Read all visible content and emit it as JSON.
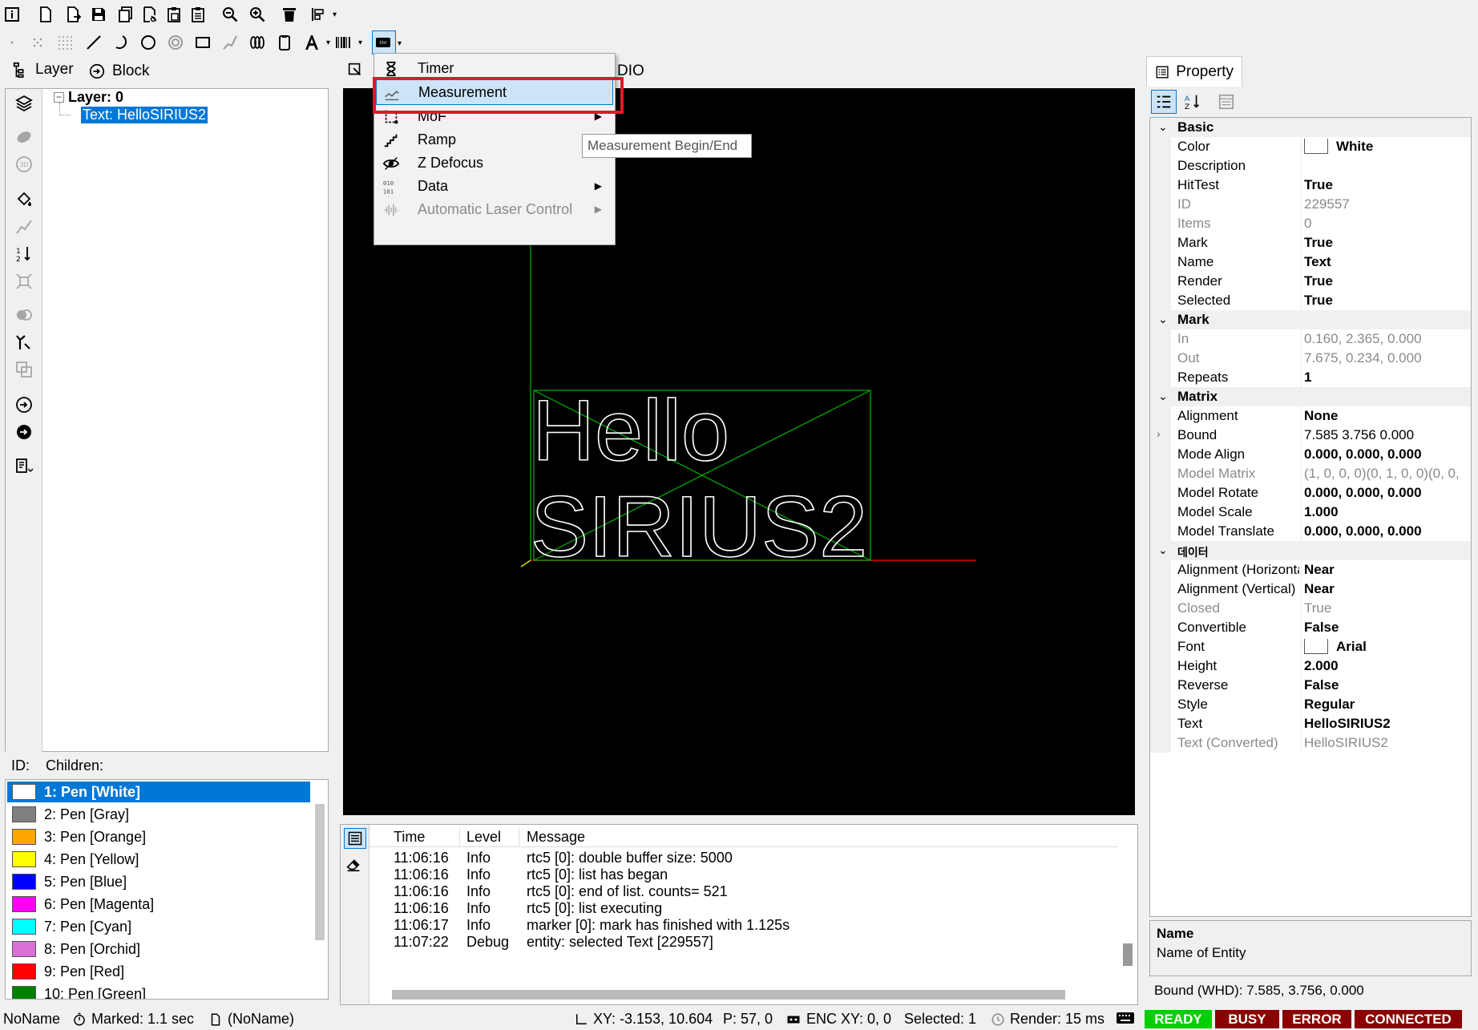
{
  "toolbar_icons": [
    "info-icon",
    "new-file-icon",
    "open-file-icon",
    "save-icon",
    "copy-icon",
    "cut-icon",
    "paste-icon",
    "clipboard-icon",
    "zoom-out-icon",
    "zoom-in-icon",
    "delete-icon",
    "align-icon",
    "point-icon",
    "points-icon",
    "grid-icon",
    "line-icon",
    "arc-icon",
    "circle-icon",
    "spiral-icon",
    "rectangle-icon",
    "trepan-icon",
    "spiral-coil-icon",
    "card-icon",
    "text-tool-icon",
    "barcode-icon",
    "control-icon"
  ],
  "left_panel": {
    "tabs": [
      {
        "label": "Layer"
      },
      {
        "label": "Block"
      }
    ],
    "tree": {
      "layer": "Layer: 0",
      "child": "Text: HelloSIRIUS2"
    },
    "id_label": "ID:",
    "children_label": "Children:"
  },
  "pens": [
    {
      "label": "1: Pen [White]",
      "color": "#ffffff"
    },
    {
      "label": "2: Pen [Gray]",
      "color": "#808080"
    },
    {
      "label": "3: Pen [Orange]",
      "color": "#ffa500"
    },
    {
      "label": "4: Pen [Yellow]",
      "color": "#ffff00"
    },
    {
      "label": "5: Pen [Blue]",
      "color": "#0000ff"
    },
    {
      "label": "6: Pen [Magenta]",
      "color": "#ff00ff"
    },
    {
      "label": "7: Pen [Cyan]",
      "color": "#00ffff"
    },
    {
      "label": "8: Pen [Orchid]",
      "color": "#da70d6"
    },
    {
      "label": "9: Pen [Red]",
      "color": "#ff0000"
    },
    {
      "label": "10: Pen [Green]",
      "color": "#008000"
    }
  ],
  "center": {
    "tab_partial": "DIO",
    "canvas_text": {
      "line1": "Hello",
      "line2": "SIRIUS2"
    }
  },
  "menu": {
    "items": [
      {
        "label": "Timer",
        "icon": "hourglass-icon",
        "submenu": false,
        "disabled": false
      },
      {
        "label": "Measurement",
        "icon": "measurement-icon",
        "submenu": false,
        "disabled": false
      },
      {
        "label": "MoF",
        "icon": "mof-icon",
        "submenu": true,
        "disabled": false
      },
      {
        "label": "Ramp",
        "icon": "ramp-icon",
        "submenu": false,
        "disabled": false
      },
      {
        "label": "Z Defocus",
        "icon": "eye-icon",
        "submenu": false,
        "disabled": false
      },
      {
        "label": "Data",
        "icon": "binary-data-icon",
        "submenu": true,
        "disabled": false
      },
      {
        "label": "Automatic Laser Control",
        "icon": "waveform-icon",
        "submenu": true,
        "disabled": true
      }
    ],
    "tooltip": "Measurement Begin/End"
  },
  "log": {
    "headers": {
      "time": "Time",
      "level": "Level",
      "message": "Message"
    },
    "rows": [
      {
        "time": "11:06:16",
        "level": "Info",
        "message": "rtc5 [0]: double buffer size: 5000"
      },
      {
        "time": "11:06:16",
        "level": "Info",
        "message": "rtc5 [0]: list has began"
      },
      {
        "time": "11:06:16",
        "level": "Info",
        "message": "rtc5 [0]: end of list. counts= 521"
      },
      {
        "time": "11:06:16",
        "level": "Info",
        "message": "rtc5 [0]: list executing"
      },
      {
        "time": "11:06:17",
        "level": "Info",
        "message": "marker [0]: mark has finished with 1.125s"
      },
      {
        "time": "11:07:22",
        "level": "Debug",
        "message": "entity: selected Text [229557]"
      }
    ]
  },
  "property": {
    "tab_label": "Property",
    "sections": [
      {
        "title": "Basic",
        "rows": [
          {
            "k": "Color",
            "v": "White",
            "bold": true,
            "swatch": true
          },
          {
            "k": "Description",
            "v": ""
          },
          {
            "k": "HitTest",
            "v": "True",
            "bold": true
          },
          {
            "k": "ID",
            "v": "229557",
            "gray": true
          },
          {
            "k": "Items",
            "v": "0",
            "gray": true
          },
          {
            "k": "Mark",
            "v": "True",
            "bold": true
          },
          {
            "k": "Name",
            "v": "Text",
            "bold": true
          },
          {
            "k": "Render",
            "v": "True",
            "bold": true
          },
          {
            "k": "Selected",
            "v": "True",
            "bold": true
          }
        ]
      },
      {
        "title": "Mark",
        "rows": [
          {
            "k": "In",
            "v": "0.160, 2.365, 0.000",
            "gray": true
          },
          {
            "k": "Out",
            "v": "7.675, 0.234, 0.000",
            "gray": true
          },
          {
            "k": "Repeats",
            "v": "1",
            "bold": true
          }
        ]
      },
      {
        "title": "Matrix",
        "rows": [
          {
            "k": "Alignment",
            "v": "None",
            "bold": true
          },
          {
            "k": "Bound",
            "v": "7.585 3.756 0.000",
            "expand": true
          },
          {
            "k": "Mode Align",
            "v": "0.000, 0.000, 0.000",
            "bold": true
          },
          {
            "k": "Model Matrix",
            "v": "(1, 0, 0, 0)(0, 1, 0, 0)(0, 0,",
            "gray": true
          },
          {
            "k": "Model Rotate",
            "v": "0.000, 0.000, 0.000",
            "bold": true
          },
          {
            "k": "Model Scale",
            "v": "1.000",
            "bold": true
          },
          {
            "k": "Model Translate",
            "v": "0.000, 0.000, 0.000",
            "bold": true
          }
        ]
      },
      {
        "title": "데이터",
        "rows": [
          {
            "k": "Alignment (Horizontal)",
            "v": "Near",
            "bold": true
          },
          {
            "k": "Alignment (Vertical)",
            "v": "Near",
            "bold": true
          },
          {
            "k": "Closed",
            "v": "True",
            "gray": true
          },
          {
            "k": "Convertible",
            "v": "False",
            "bold": true
          },
          {
            "k": "Font",
            "v": "Arial",
            "bold": true,
            "swatch": true
          },
          {
            "k": "Height",
            "v": "2.000",
            "bold": true
          },
          {
            "k": "Reverse",
            "v": "False",
            "bold": true
          },
          {
            "k": "Style",
            "v": "Regular",
            "bold": true
          },
          {
            "k": "Text",
            "v": "HelloSIRIUS2",
            "bold": true
          },
          {
            "k": "Text (Converted)",
            "v": "HelloSIRIUS2",
            "gray": true
          }
        ]
      }
    ],
    "desc_title": "Name",
    "desc_text": "Name of Entity",
    "bound": "Bound (WHD): 7.585, 3.756, 0.000"
  },
  "status": {
    "filename": "NoName",
    "marked": "Marked: 1.1 sec",
    "doc": "(NoName)",
    "xy": "XY: -3.153, 10.604",
    "p": "P: 57, 0",
    "enc": "ENC XY: 0, 0",
    "selected": "Selected: 1",
    "render": "Render: 15 ms",
    "badges": [
      {
        "label": "READY",
        "color": "#00d000"
      },
      {
        "label": "BUSY",
        "color": "#8b0000"
      },
      {
        "label": "ERROR",
        "color": "#8b0000"
      },
      {
        "label": "CONNECTED",
        "color": "#8b0000"
      }
    ]
  }
}
